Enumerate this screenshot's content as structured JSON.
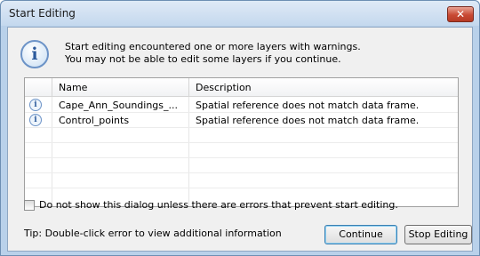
{
  "window": {
    "title": "Start Editing",
    "close_glyph": "✕"
  },
  "message": {
    "line1": "Start editing encountered one or more layers with warnings.",
    "line2": "You may not be able to edit some layers if you continue.",
    "icon": "info-icon"
  },
  "grid": {
    "columns": [
      "Name",
      "Description"
    ],
    "rows": [
      {
        "icon": "info-icon",
        "name": "Cape_Ann_Soundings_...",
        "description": "Spatial reference does not match data frame."
      },
      {
        "icon": "info-icon",
        "name": "Control_points",
        "description": "Spatial reference does not match data frame."
      }
    ]
  },
  "checkbox": {
    "label": "Do not show this dialog unless there are errors that prevent start editing.",
    "checked": false
  },
  "tip": "Tip: Double-click error to view additional information",
  "buttons": {
    "continue": "Continue",
    "stop_editing": "Stop Editing"
  },
  "colors": {
    "close_button": "#c94a34",
    "info_icon": "#2c5a9c"
  }
}
